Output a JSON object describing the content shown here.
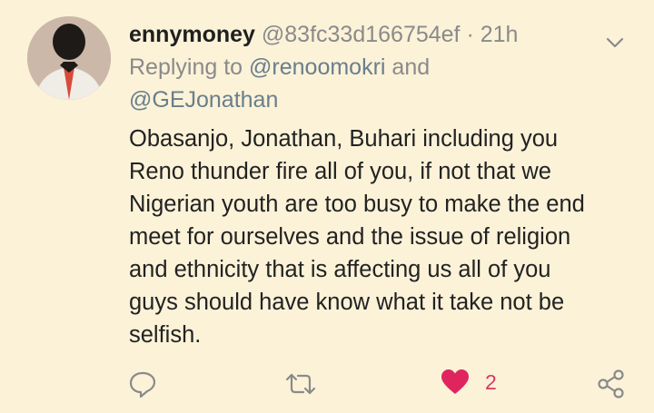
{
  "tweet": {
    "display_name": "ennymoney",
    "handle": "@83fc33d166754ef",
    "separator": "·",
    "time": "21h",
    "replying_prefix": "Replying to ",
    "reply_handle_1": "@renoomokri",
    "reply_joiner": " and",
    "reply_handle_2": "@GEJonathan",
    "lines": [
      "Obasanjo, Jonathan, Buhari including you",
      "Reno thunder fire all of you, if not that we",
      "Nigerian youth are too busy to make the end",
      "meet for ourselves and the issue of religion",
      "and ethnicity that is affecting us all of you",
      "guys should have know what it take not be",
      "selfish."
    ]
  },
  "actions": {
    "like_count": "2",
    "liked": true,
    "icons": [
      "reply-icon",
      "retweet-icon",
      "heart-icon",
      "share-icon"
    ]
  },
  "colors": {
    "background": "#fbf2d8",
    "like": "#e0245e",
    "muted": "#8a8a8a"
  }
}
